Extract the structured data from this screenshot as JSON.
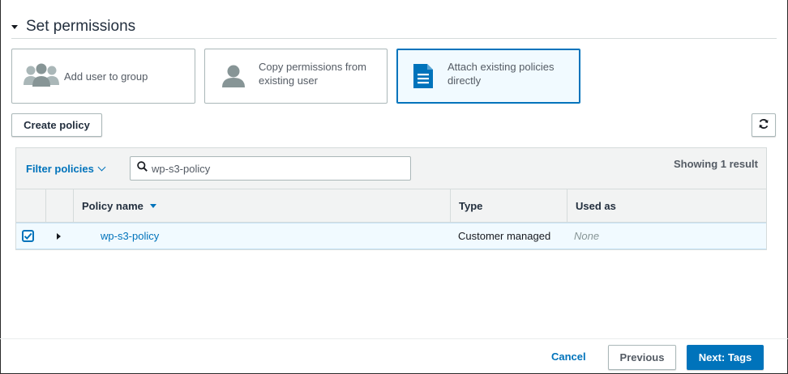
{
  "section": {
    "title": "Set permissions",
    "expanded_icon": "caret-down-icon"
  },
  "options": [
    {
      "label": "Add user to group",
      "icon": "user-group-icon",
      "selected": false
    },
    {
      "label_line1": "Copy permissions from",
      "label_line2": "existing user",
      "icon": "user-icon",
      "selected": false
    },
    {
      "label_line1": "Attach existing policies",
      "label_line2": "directly",
      "icon": "document-icon",
      "selected": true
    }
  ],
  "toolbar": {
    "create_label": "Create policy",
    "refresh_icon": "refresh-icon"
  },
  "filter": {
    "label": "Filter policies",
    "search_value": "wp-s3-policy",
    "result_text": "Showing 1 result"
  },
  "table": {
    "columns": {
      "name": "Policy name",
      "type": "Type",
      "used": "Used as"
    },
    "rows": [
      {
        "checked": true,
        "name": "wp-s3-policy",
        "type": "Customer managed",
        "used": "None"
      }
    ]
  },
  "footer": {
    "cancel": "Cancel",
    "previous": "Previous",
    "next": "Next: Tags"
  },
  "colors": {
    "accent": "#0073bb",
    "selected_bg": "#f1faff",
    "header_bg": "#f2f3f3",
    "border": "#aab7b8"
  }
}
